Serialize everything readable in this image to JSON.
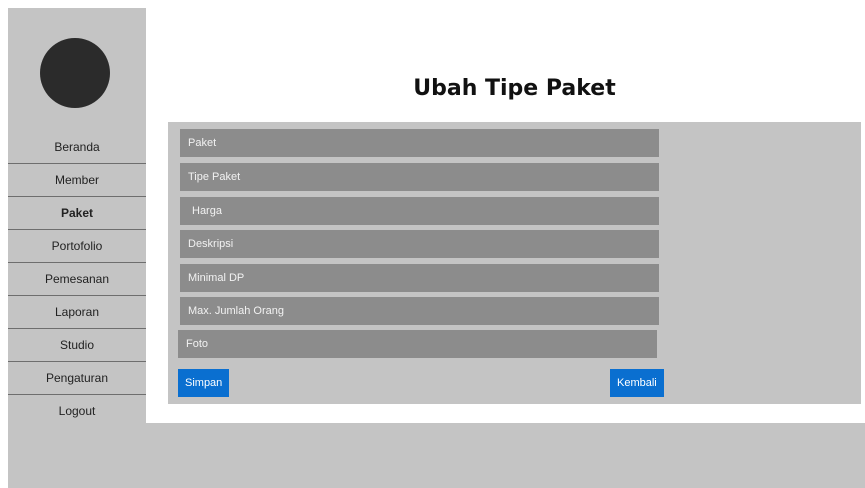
{
  "title": "Ubah Tipe Paket",
  "sidebar": {
    "items": [
      {
        "label": "Beranda"
      },
      {
        "label": "Member"
      },
      {
        "label": "Paket"
      },
      {
        "label": "Portofolio"
      },
      {
        "label": "Pemesanan"
      },
      {
        "label": "Laporan"
      },
      {
        "label": "Studio"
      },
      {
        "label": "Pengaturan"
      },
      {
        "label": "Logout"
      }
    ],
    "active": "Paket"
  },
  "form": {
    "fields": [
      {
        "placeholder": "Paket",
        "value": ""
      },
      {
        "placeholder": "Tipe Paket",
        "value": ""
      },
      {
        "placeholder": "Harga",
        "value": ""
      },
      {
        "placeholder": "Deskripsi",
        "value": ""
      },
      {
        "placeholder": "Minimal DP",
        "value": ""
      },
      {
        "placeholder": "Max. Jumlah Orang",
        "value": ""
      },
      {
        "placeholder": "Foto",
        "value": ""
      }
    ],
    "save_label": "Simpan",
    "back_label": "Kembali"
  },
  "colors": {
    "sidebar_bg": "#c4c4c4",
    "field_bg": "#8c8c8c",
    "button_bg": "#0a6fd0",
    "avatar": "#2b2b2b"
  }
}
